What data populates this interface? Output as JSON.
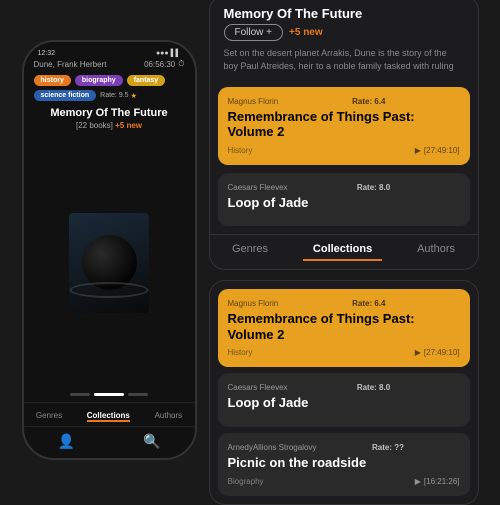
{
  "phone": {
    "status_time": "12:32",
    "status_signal": "●●●",
    "header_title": "Dune, Frank Herbert",
    "header_time": "06:56:30",
    "tags": [
      {
        "label": "history",
        "class": "tag-orange"
      },
      {
        "label": "biography",
        "class": "tag-purple"
      },
      {
        "label": "fantasy",
        "class": "tag-yellow"
      },
      {
        "label": "science fiction",
        "class": "tag-blue"
      }
    ],
    "rate_label": "Rate: 9.5",
    "book_title": "Memory Of The Future",
    "book_info": "[22 books]",
    "book_new": "+5 new",
    "tabs": [
      "Genres",
      "Collections",
      "Authors"
    ],
    "active_tab": "Collections"
  },
  "right": {
    "top_card": {
      "title": "Memory Of The Future",
      "info": "[22 books]",
      "new": "+5 new",
      "follow_label": "Follow +",
      "description": "Set on the desert planet Arrakis, Dune is the story of the boy Paul Atreides, heir to a noble family tasked with ruling",
      "book1": {
        "author": "Magnus Florin",
        "rate": "Rate: 6.4",
        "title": "Remembrance of Things Past: Volume 2",
        "genre": "History",
        "duration": "[27:49:10]"
      },
      "book2": {
        "author": "Caesars Fleevex",
        "rate": "Rate: 8.0",
        "title": "Loop of Jade",
        "genre": "",
        "duration": ""
      },
      "tabs": [
        "Genres",
        "Collections",
        "Authors"
      ],
      "active_tab": "Collections"
    },
    "bottom_card": {
      "book1": {
        "author": "Magnus Florin",
        "rate": "Rate: 6.4",
        "title": "Remembrance of Things Past: Volume 2",
        "genre": "History",
        "duration": "[27:49:10]"
      },
      "book2": {
        "author": "Caesars Fleevex",
        "rate": "Rate: 8.0",
        "title": "Loop of Jade",
        "genre": "",
        "duration": ""
      },
      "book3": {
        "author": "ArnedyAllions Strogalovy",
        "rate": "Rate: ??",
        "title": "Picnic on the roadside",
        "genre": "Biography",
        "duration": "[16:21:26]"
      }
    }
  }
}
